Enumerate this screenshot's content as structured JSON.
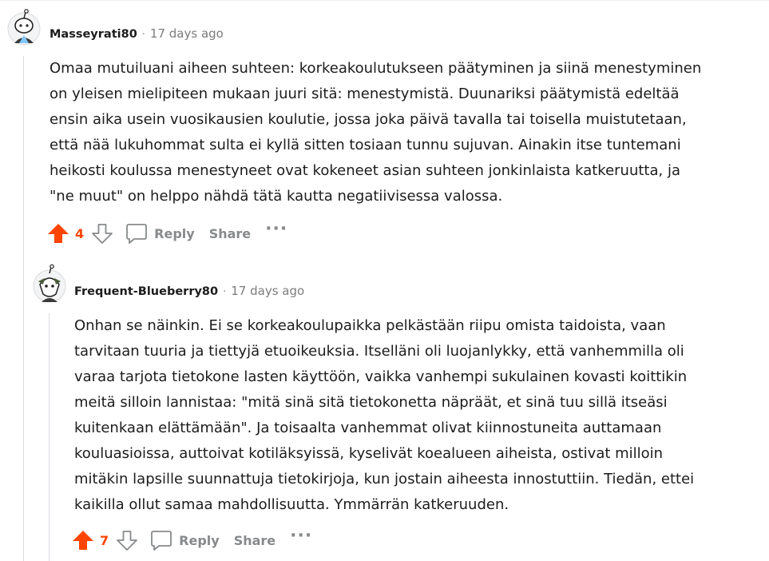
{
  "comments": [
    {
      "author": "Masseyrati80",
      "separator": "·",
      "time": "17 days ago",
      "lines": [
        "Omaa mutuiluani aiheen suhteen: korkeakoulutukseen päätyminen ja siinä menestyminen",
        "on yleisen mielipiteen mukaan juuri sitä: menestymistä. Duunariksi päätymistä edeltää",
        "ensin aika usein vuosikausien koulutie, jossa joka päivä tavalla tai toisella muistutetaan,",
        "että nää lukuhommat sulta ei kyllä sitten tosiaan tunnu sujuvan. Ainakin itse tuntemani",
        "heikosti koulussa menestyneet ovat kokeneet asian suhteen jonkinlaista katkeruutta, ja",
        "\"ne muut\" on helppo nähdä tätä kautta negatiivisessa valossa."
      ],
      "votes": "4",
      "reply_label": "Reply",
      "share_label": "Share",
      "more_label": "···"
    },
    {
      "author": "Frequent-Blueberry80",
      "separator": "·",
      "time": "17 days ago",
      "lines": [
        "Onhan se näinkin. Ei se korkeakoulupaikka pelkästään riipu omista taidoista, vaan",
        "tarvitaan tuuria ja tiettyjä etuoikeuksia. Itselläni oli luojanlykky, että vanhemmilla oli",
        "varaa tarjota tietokone lasten käyttöön, vaikka vanhempi sukulainen kovasti koittikin",
        "meitä silloin lannistaa: \"mitä sinä sitä tietokonetta näpräät, et sinä tuu sillä itseäsi",
        "kuitenkaan elättämään\". Ja toisaalta vanhemmat olivat kiinnostuneita auttamaan",
        "kouluasioissa, auttoivat kotiläksyissä, kyselivät koealueen aiheista, ostivat milloin",
        "mitäkin lapsille suunnattuja tietokirjoja, kun jostain aiheesta innostuttiin. Tiedän, ettei",
        "kaikilla ollut samaa mahdollisuutta. Ymmärrän katkeruuden."
      ],
      "votes": "7",
      "reply_label": "Reply",
      "share_label": "Share",
      "more_label": "···"
    }
  ],
  "colors": {
    "upvote": "#ff4500",
    "muted": "#878a8c",
    "thread": "#dadce0"
  }
}
